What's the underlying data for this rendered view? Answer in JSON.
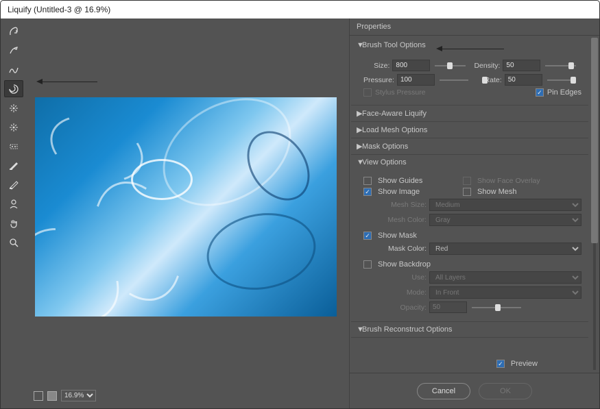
{
  "title": "Liquify (Untitled-3 @ 16.9%)",
  "zoom": "16.9%",
  "panel_title": "Properties",
  "sections": {
    "brush": "Brush Tool Options",
    "face": "Face-Aware Liquify",
    "load": "Load Mesh Options",
    "maskopt": "Mask Options",
    "view": "View Options",
    "reconstruct": "Brush Reconstruct Options"
  },
  "brush": {
    "size_l": "Size:",
    "size": "800",
    "density_l": "Density:",
    "density": "50",
    "pressure_l": "Pressure:",
    "pressure": "100",
    "rate_l": "Rate:",
    "rate": "50",
    "stylus": "Stylus Pressure",
    "pin": "Pin Edges"
  },
  "view": {
    "guides": "Show Guides",
    "faceov": "Show Face Overlay",
    "image": "Show Image",
    "mesh": "Show Mesh",
    "meshsize_l": "Mesh Size:",
    "meshsize": "Medium",
    "meshcolor_l": "Mesh Color:",
    "meshcolor": "Gray",
    "mask": "Show Mask",
    "maskcolor_l": "Mask Color:",
    "maskcolor": "Red",
    "backdrop": "Show Backdrop",
    "use_l": "Use:",
    "use": "All Layers",
    "mode_l": "Mode:",
    "mode": "In Front",
    "opacity_l": "Opacity:",
    "opacity": "50"
  },
  "preview": "Preview",
  "cancel": "Cancel",
  "ok": "OK",
  "tools": [
    "forward-warp",
    "reconstruct",
    "smooth",
    "twirl",
    "pucker",
    "bloat",
    "push-left",
    "freeze-mask",
    "thaw-mask",
    "face",
    "hand",
    "zoom"
  ]
}
